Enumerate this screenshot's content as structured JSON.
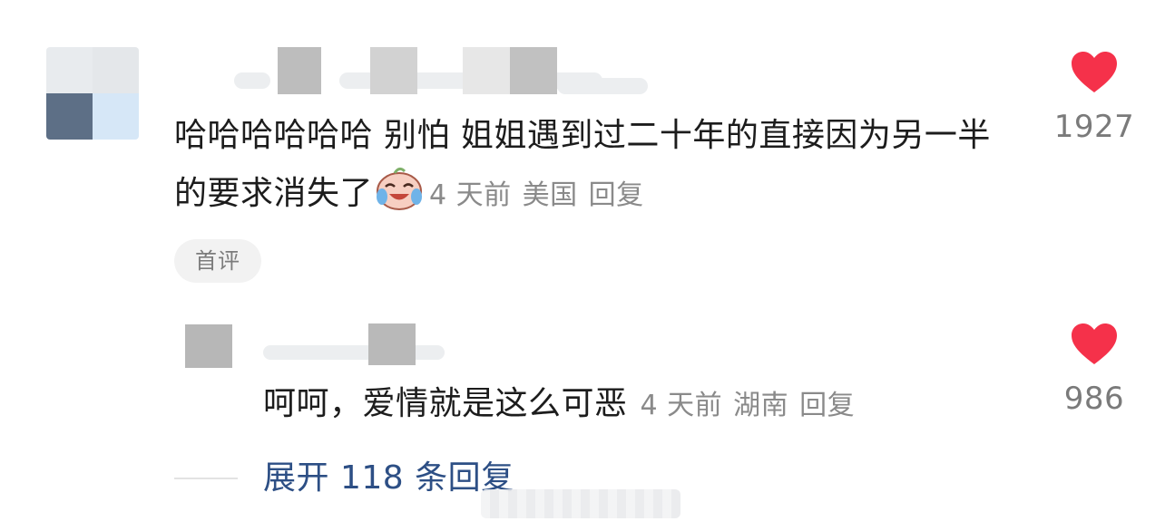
{
  "comment": {
    "text": "哈哈哈哈哈哈 别怕 姐姐遇到过二十年的直接因为另一半的要求消失了",
    "emoji": "crying-laughing-face-icon",
    "time": "4 天前",
    "location": "美国",
    "reply_label": "回复",
    "badge": "首评",
    "likes": "1927"
  },
  "reply": {
    "text": "呵呵，爱情就是这么可恶",
    "time": "4 天前",
    "location": "湖南",
    "reply_label": "回复",
    "likes": "986"
  },
  "expand": {
    "label": "展开 118 条回复"
  },
  "colors": {
    "heart": "#f5314a",
    "link": "#2d4f85",
    "meta": "#8a8a8a"
  }
}
